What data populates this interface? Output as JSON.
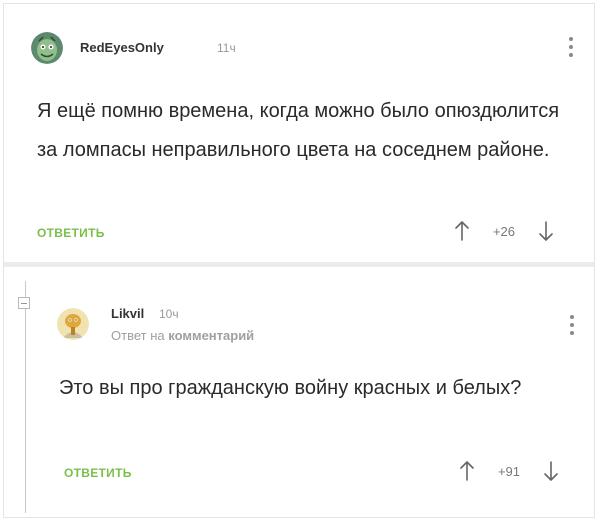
{
  "comments": [
    {
      "username": "RedEyesOnly",
      "time": "11ч",
      "text": "Я ещё помню времена, когда можно было опюздюлится за ломпасы неправильного цвета на соседнем районе.",
      "reply_label": "ОТВЕТИТЬ",
      "score": "+26",
      "avatar_icon": "green-monster-avatar"
    },
    {
      "username": "Likvil",
      "time": "10ч",
      "reply_prefix": "Ответ на",
      "reply_target": "комментарий",
      "text": "Это вы про гражданскую войну красных и белых?",
      "reply_label": "ОТВЕТИТЬ",
      "score": "+91",
      "avatar_icon": "cartoon-character-avatar"
    }
  ],
  "colors": {
    "accent_green": "#7bbf4a",
    "muted_gray": "#9a9a9a",
    "text": "#2a2a2a"
  }
}
